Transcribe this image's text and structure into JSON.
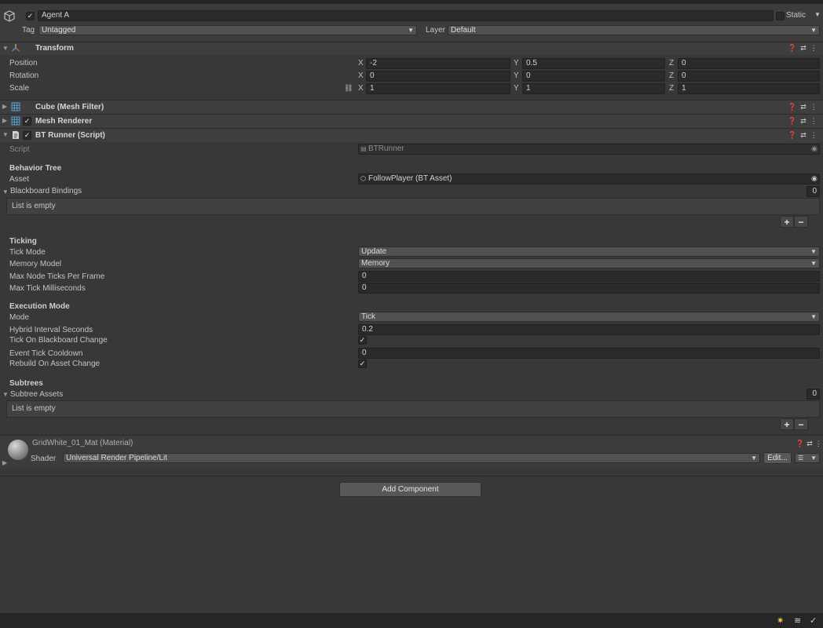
{
  "object": {
    "name": "Agent A",
    "static_label": "Static",
    "tag_label": "Tag",
    "tag_value": "Untagged",
    "layer_label": "Layer",
    "layer_value": "Default"
  },
  "transform": {
    "title": "Transform",
    "rows": [
      {
        "label": "Position",
        "x": "-2",
        "y": "0.5",
        "z": "0"
      },
      {
        "label": "Rotation",
        "x": "0",
        "y": "0",
        "z": "0"
      },
      {
        "label": "Scale",
        "x": "1",
        "y": "1",
        "z": "1"
      }
    ],
    "axes": [
      "X",
      "Y",
      "Z"
    ]
  },
  "components": {
    "mesh_filter": "Cube (Mesh Filter)",
    "mesh_renderer": "Mesh Renderer",
    "bt_runner": "BT Runner (Script)"
  },
  "bt_runner": {
    "script_label": "Script",
    "script_value": "BTRunner",
    "behavior_tree_header": "Behavior Tree",
    "asset_label": "Asset",
    "asset_value": "FollowPlayer (BT Asset)",
    "bindings_label": "Blackboard Bindings",
    "bindings_count": "0",
    "list_empty": "List is empty",
    "ticking_header": "Ticking",
    "tick_mode_label": "Tick Mode",
    "tick_mode_value": "Update",
    "memory_model_label": "Memory Model",
    "memory_model_value": "Memory",
    "max_node_ticks_label": "Max Node Ticks Per Frame",
    "max_node_ticks_value": "0",
    "max_tick_ms_label": "Max Tick Milliseconds",
    "max_tick_ms_value": "0",
    "execution_header": "Execution Mode",
    "mode_label": "Mode",
    "mode_value": "Tick",
    "hybrid_label": "Hybrid Interval Seconds",
    "hybrid_value": "0.2",
    "tick_on_bb_label": "Tick On Blackboard Change",
    "event_cooldown_label": "Event Tick Cooldown",
    "event_cooldown_value": "0",
    "rebuild_label": "Rebuild On Asset Change",
    "subtrees_header": "Subtrees",
    "subtree_assets_label": "Subtree Assets",
    "subtree_assets_count": "0",
    "subtree_list_empty": "List is empty",
    "plus": "+",
    "minus": "−"
  },
  "material": {
    "name": "GridWhite_01_Mat (Material)",
    "shader_label": "Shader",
    "shader_value": "Universal Render Pipeline/Lit",
    "edit_label": "Edit..."
  },
  "add_component_label": "Add Component",
  "icons": {
    "help": "help-icon",
    "presets": "presets-icon",
    "menu": "kebab-menu-icon"
  }
}
